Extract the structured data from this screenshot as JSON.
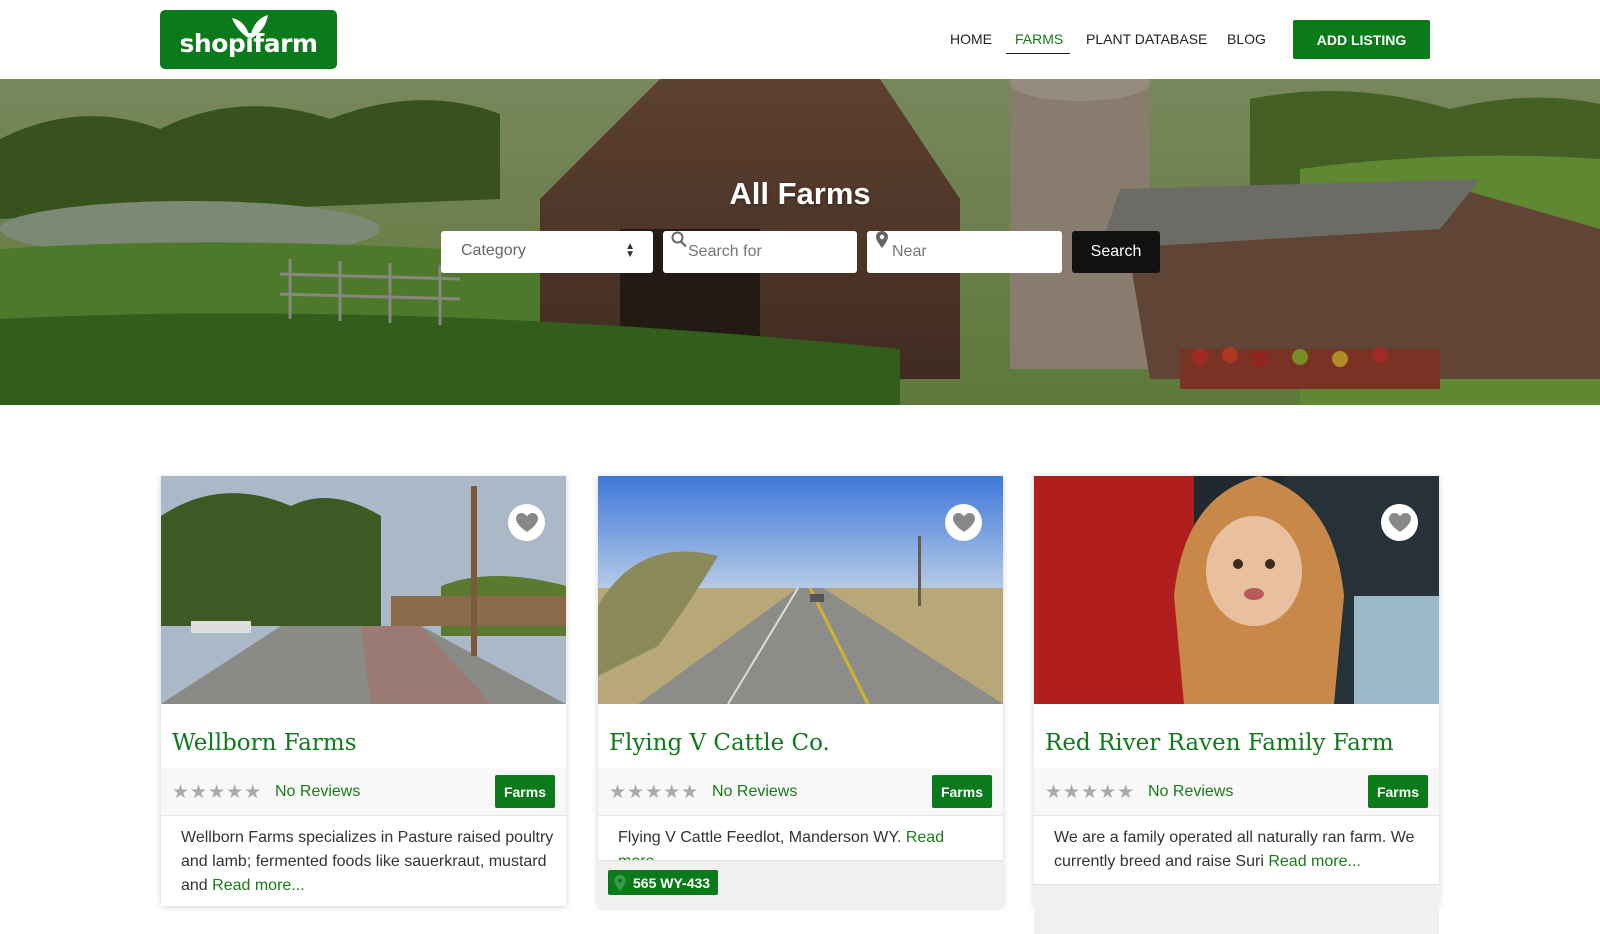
{
  "header": {
    "logo_text": "shopifarm",
    "nav": [
      {
        "label": "HOME"
      },
      {
        "label": "FARMS",
        "active": true
      },
      {
        "label": "PLANT DATABASE"
      },
      {
        "label": "BLOG"
      }
    ],
    "add_listing_label": "ADD LISTING"
  },
  "hero": {
    "title": "All Farms",
    "category_select": {
      "selected": "Category"
    },
    "search_placeholder": "Search for",
    "near_placeholder": "Near",
    "search_button_label": "Search"
  },
  "cards": [
    {
      "title": "Wellborn Farms",
      "rating_stars": 0,
      "reviews_label": "No Reviews",
      "badge": "Farms",
      "description": "Wellborn Farms specializes in Pasture raised poultry and lamb; fermented foods like sauerkraut, mustard and",
      "read_more": "Read more...",
      "address": ""
    },
    {
      "title": "Flying V Cattle Co.",
      "rating_stars": 0,
      "reviews_label": "No Reviews",
      "badge": "Farms",
      "description": "Flying V Cattle Feedlot, Manderson WY.",
      "read_more": "Read more...",
      "address": "565 WY-433"
    },
    {
      "title": "Red River Raven Family Farm",
      "rating_stars": 0,
      "reviews_label": "No Reviews",
      "badge": "Farms",
      "description": "We are a family operated all naturally ran farm. We currently breed and raise Suri",
      "read_more": "Read more...",
      "address": ""
    }
  ],
  "colors": {
    "brand_green": "#0a7a1a",
    "link_green": "#1a7a1a",
    "search_button": "#111111"
  }
}
